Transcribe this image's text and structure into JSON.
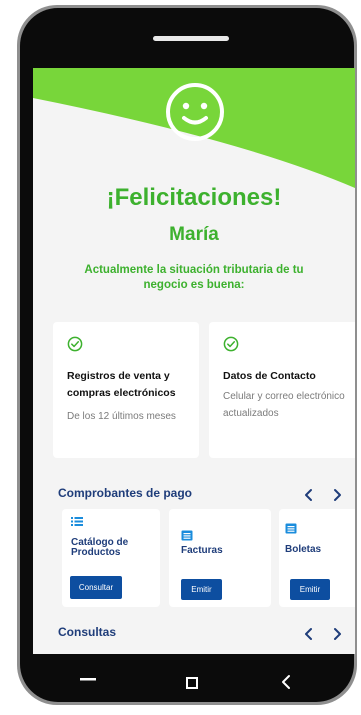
{
  "colors": {
    "green": "#3db12e",
    "header_green": "#78d63a",
    "navy": "#1f3d7a",
    "button_blue": "#0d4ea0"
  },
  "header": {
    "icon": "smiley-face-icon",
    "title": "¡Felicitaciones!",
    "name": "María",
    "message": "Actualmente la situación tributaria de tu negocio es buena:"
  },
  "status_cards": [
    {
      "icon": "check-circle-icon",
      "title": "Registros de venta y compras electrónicos",
      "description": "De los 12 últimos meses"
    },
    {
      "icon": "check-circle-icon",
      "title": "Datos de Contacto",
      "description": "Celular y correo electrónico actualizados"
    }
  ],
  "comprobantes": {
    "title": "Comprobantes de pago",
    "prev_icon": "chevron-left-icon",
    "next_icon": "chevron-right-icon",
    "items": [
      {
        "icon": "list-icon",
        "label": "Catálogo de Productos",
        "button": "Consultar"
      },
      {
        "icon": "document-icon",
        "label": "Facturas",
        "button": "Emitir"
      },
      {
        "icon": "document-icon",
        "label": "Boletas",
        "button": "Emitir"
      }
    ]
  },
  "consultas": {
    "title": "Consultas",
    "prev_icon": "chevron-left-icon",
    "next_icon": "chevron-right-icon"
  },
  "system_nav": {
    "menu_icon": "menu-icon",
    "home_icon": "square-home-icon",
    "back_icon": "back-chevron-icon"
  }
}
